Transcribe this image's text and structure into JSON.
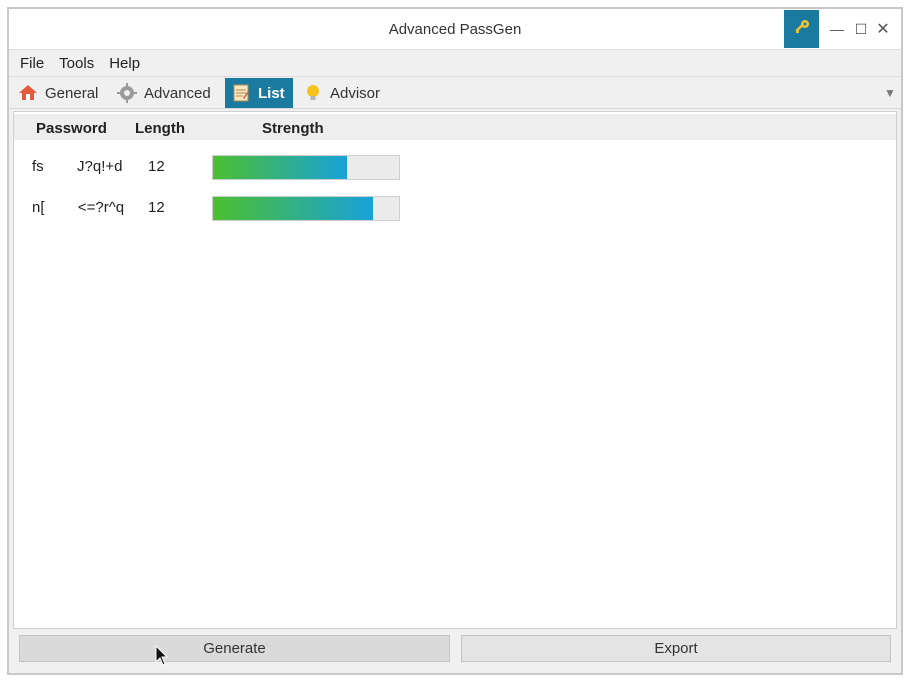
{
  "window": {
    "title": "Advanced PassGen",
    "key_icon": "key-icon",
    "minimize_glyph": "—",
    "maximize_glyph": "☐",
    "close_glyph": "✕"
  },
  "menu": {
    "items": [
      {
        "label": "File"
      },
      {
        "label": "Tools"
      },
      {
        "label": "Help"
      }
    ]
  },
  "tabs": [
    {
      "label": "General",
      "icon": "home-icon",
      "selected": false
    },
    {
      "label": "Advanced",
      "icon": "gear-icon",
      "selected": false
    },
    {
      "label": "List",
      "icon": "notepad-icon",
      "selected": true
    },
    {
      "label": "Advisor",
      "icon": "lightbulb-icon",
      "selected": false
    }
  ],
  "tab_overflow_glyph": "▼",
  "grid": {
    "columns": [
      "Password",
      "Length",
      "Strength"
    ],
    "rows": [
      {
        "password": "fs        J?q!+d",
        "length": "12",
        "strength": 0.72
      },
      {
        "password": "n[        <=?r^q",
        "length": "12",
        "strength": 0.86
      }
    ]
  },
  "footer": {
    "generate_label": "Generate",
    "export_label": "Export"
  },
  "colors": {
    "accent": "#1b7aa0",
    "bar_start": "#4cbf2f",
    "bar_end": "#19a2d9"
  }
}
